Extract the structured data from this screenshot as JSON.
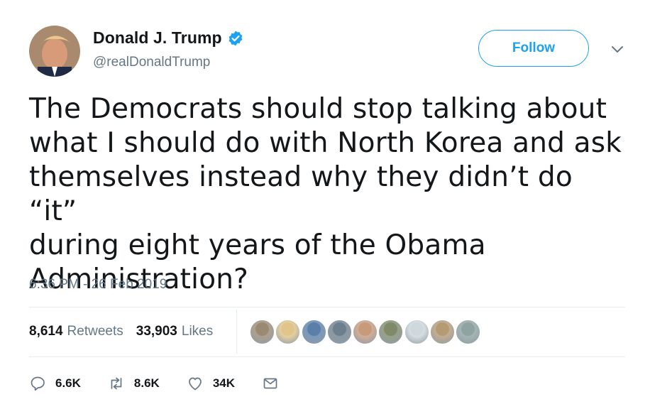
{
  "user": {
    "display_name": "Donald J. Trump",
    "handle": "@realDonaldTrump",
    "verified": true
  },
  "follow_button": {
    "label": "Follow"
  },
  "tweet": {
    "text": "The Democrats should stop talking about\nwhat I should do with North Korea and ask\nthemselves instead why they didn’t do “it”\nduring eight years of the Obama\nAdministration?",
    "timestamp": "6:36 PM - 26 Feb 2019"
  },
  "stats": {
    "retweets_count": "8,614",
    "retweets_label": "Retweets",
    "likes_count": "33,903",
    "likes_label": "Likes"
  },
  "liker_avatars": [
    {
      "color": "#9a8a72"
    },
    {
      "color": "#e0c48a"
    },
    {
      "color": "#5b7fa8"
    },
    {
      "color": "#6d7f8c"
    },
    {
      "color": "#c79a7c"
    },
    {
      "color": "#7e8a6a"
    },
    {
      "color": "#cfd8dc"
    },
    {
      "color": "#b59a76"
    },
    {
      "color": "#8fa3a0"
    }
  ],
  "actions": {
    "replies": "6.6K",
    "retweets": "8.6K",
    "likes": "34K"
  },
  "colors": {
    "accent": "#1da1f2",
    "secondary_text": "#657786",
    "primary_text": "#14171a",
    "divider": "#e6ecf0"
  }
}
